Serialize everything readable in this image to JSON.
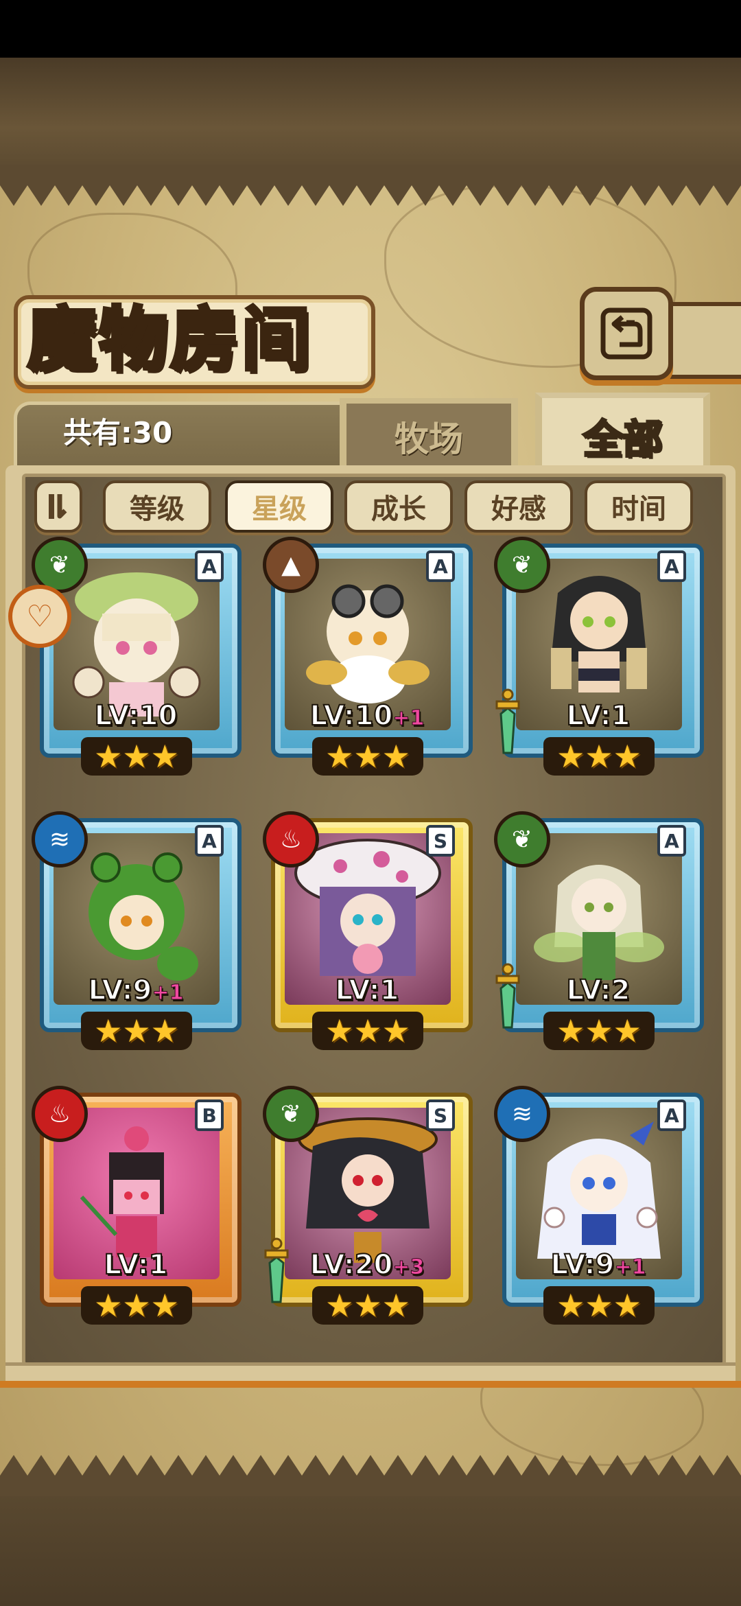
{
  "title": "魔物房间",
  "count_text": "共有:30",
  "tabs": {
    "ranch": "牧场",
    "all": "全部"
  },
  "sort": {
    "toggle_icon": "sort-toggle-icon",
    "buttons": [
      "等级",
      "星级",
      "成长",
      "好感",
      "时间"
    ],
    "active": "星级"
  },
  "cards": [
    {
      "rank": "A",
      "element": "leaf",
      "lv": "LV:10",
      "plus": "",
      "stars": "★★★",
      "frame": "blue",
      "sword": false
    },
    {
      "rank": "A",
      "element": "earth",
      "lv": "LV:10",
      "plus": "+1",
      "stars": "★★★",
      "frame": "blue",
      "sword": false
    },
    {
      "rank": "A",
      "element": "leaf",
      "lv": "LV:1",
      "plus": "",
      "stars": "★★★",
      "frame": "blue",
      "sword": true
    },
    {
      "rank": "A",
      "element": "water",
      "lv": "LV:9",
      "plus": "+1",
      "stars": "★★★",
      "frame": "blue",
      "sword": false
    },
    {
      "rank": "S",
      "element": "fire",
      "lv": "LV:1",
      "plus": "",
      "stars": "★★★",
      "frame": "gold",
      "sword": false
    },
    {
      "rank": "A",
      "element": "leaf",
      "lv": "LV:2",
      "plus": "",
      "stars": "★★★",
      "frame": "blue",
      "sword": true
    },
    {
      "rank": "B",
      "element": "fire",
      "lv": "LV:1",
      "plus": "",
      "stars": "★★★",
      "frame": "orange",
      "sword": false
    },
    {
      "rank": "S",
      "element": "leaf",
      "lv": "LV:20",
      "plus": "+3",
      "stars": "★★★",
      "frame": "gold",
      "sword": true
    },
    {
      "rank": "A",
      "element": "water",
      "lv": "LV:9",
      "plus": "+1",
      "stars": "★★★",
      "frame": "blue",
      "sword": false
    }
  ],
  "colors": {
    "accent_orange": "#cf7b22",
    "parchment": "#d9c79a",
    "active_sort": "#fbf3dd"
  }
}
